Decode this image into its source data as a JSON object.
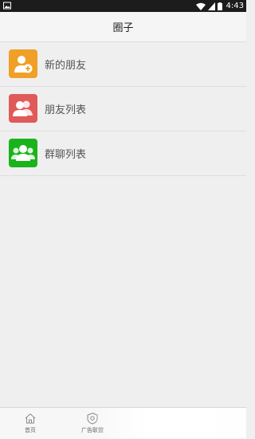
{
  "status_bar": {
    "time": "4:43",
    "icons": [
      "image-icon",
      "wifi-icon",
      "signal-icon",
      "battery-icon"
    ]
  },
  "header": {
    "title": "圈子"
  },
  "menu": {
    "items": [
      {
        "label": "新的朋友",
        "icon": "add-friend-icon",
        "color": "#f0a026"
      },
      {
        "label": "朋友列表",
        "icon": "friends-icon",
        "color": "#e05a5a"
      },
      {
        "label": "群聊列表",
        "icon": "group-chat-icon",
        "color": "#1bb31b"
      }
    ]
  },
  "tab_bar": {
    "tabs": [
      {
        "label": "首页",
        "icon": "home-icon"
      },
      {
        "label": "广告联盟",
        "icon": "ad-alliance-icon"
      }
    ]
  }
}
